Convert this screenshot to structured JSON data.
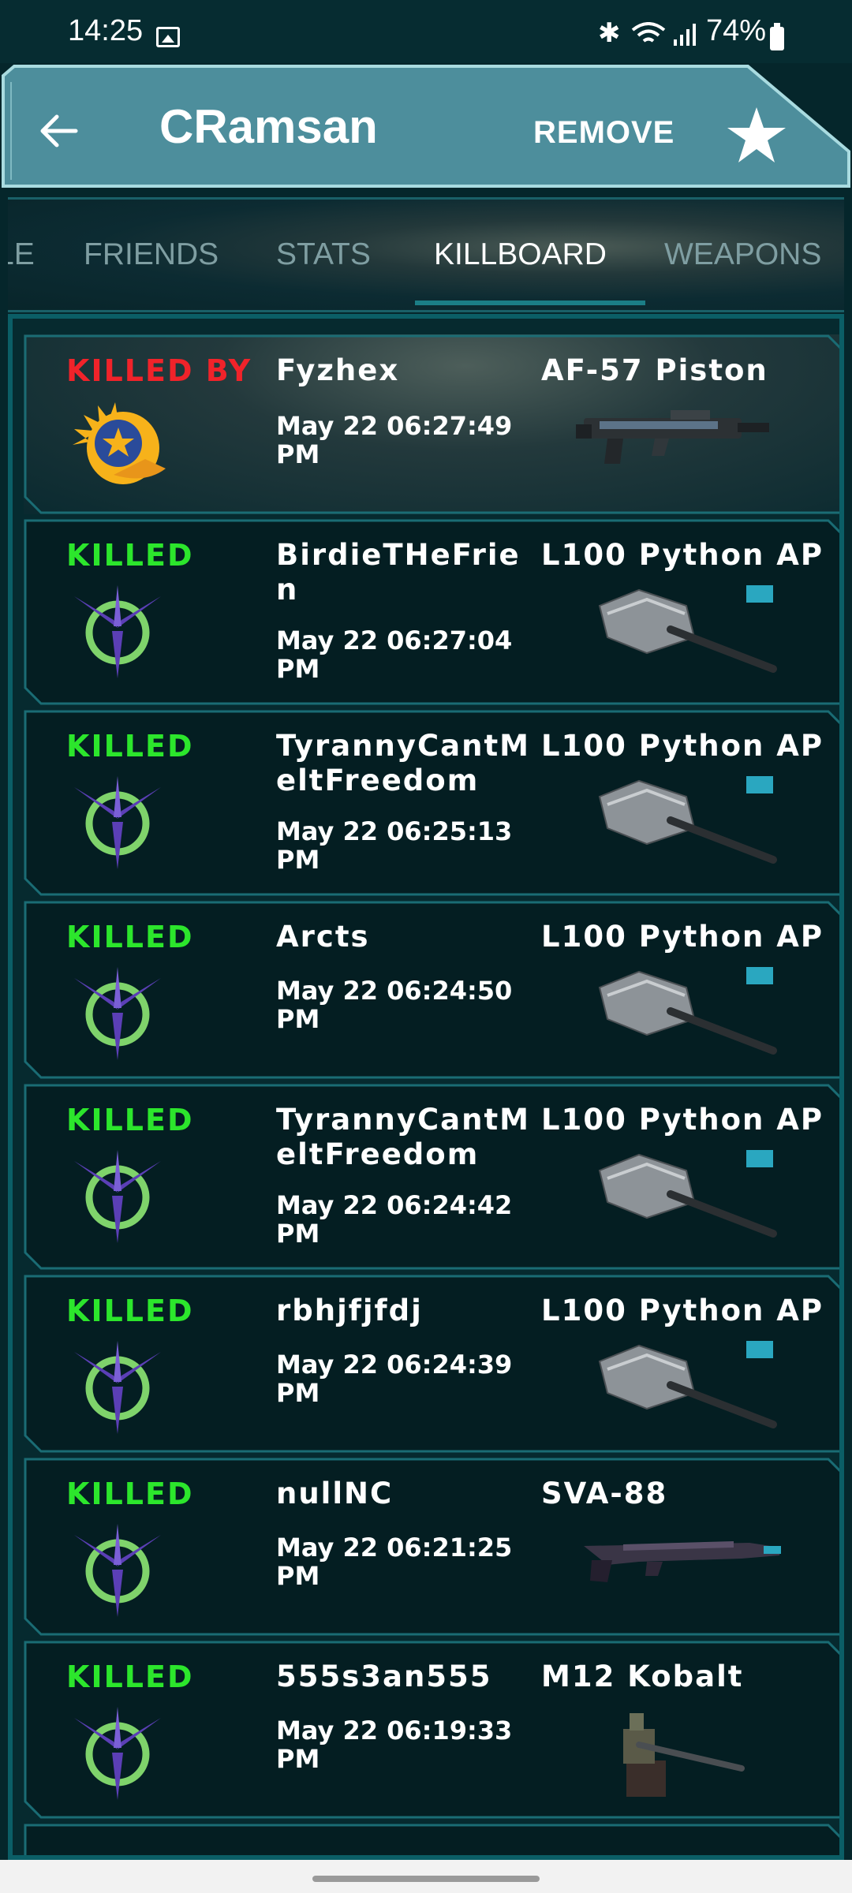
{
  "status_bar": {
    "time": "14:25",
    "battery": "74%",
    "icons": [
      "gallery-icon",
      "bluetooth-icon",
      "wifi-icon",
      "signal-icon",
      "battery-icon"
    ]
  },
  "header": {
    "title": "CRamsan",
    "remove_label": "REMOVE",
    "back_icon": "arrow-left-icon",
    "favorite_icon": "star-icon"
  },
  "tabs": [
    {
      "label": "LE",
      "active": false
    },
    {
      "label": "FRIENDS",
      "active": false
    },
    {
      "label": "STATS",
      "active": false
    },
    {
      "label": "KILLBOARD",
      "active": true
    },
    {
      "label": "WEAPONS",
      "active": false
    }
  ],
  "kills": [
    {
      "status": "KILLED BY",
      "player": "Fyzhex",
      "time": "May 22 06:27:49 PM",
      "weapon": "AF-57 Piston",
      "emblem": "sun-eagle-emblem",
      "weapon_icon": "rifle"
    },
    {
      "status": "KILLED",
      "player": "BirdieTHeFrien",
      "time": "May 22 06:27:04 PM",
      "weapon": "L100 Python AP",
      "emblem": "star-ring-emblem",
      "weapon_icon": "turret"
    },
    {
      "status": "KILLED",
      "player": "TyrannyCantMeltFreedom",
      "time": "May 22 06:25:13 PM",
      "weapon": "L100 Python AP",
      "emblem": "star-ring-emblem",
      "weapon_icon": "turret"
    },
    {
      "status": "KILLED",
      "player": "Arcts",
      "time": "May 22 06:24:50 PM",
      "weapon": "L100 Python AP",
      "emblem": "star-ring-emblem",
      "weapon_icon": "turret"
    },
    {
      "status": "KILLED",
      "player": "TyrannyCantMeltFreedom",
      "time": "May 22 06:24:42 PM",
      "weapon": "L100 Python AP",
      "emblem": "star-ring-emblem",
      "weapon_icon": "turret"
    },
    {
      "status": "KILLED",
      "player": "rbhjfjfdj",
      "time": "May 22 06:24:39 PM",
      "weapon": "L100 Python AP",
      "emblem": "star-ring-emblem",
      "weapon_icon": "turret"
    },
    {
      "status": "KILLED",
      "player": "nullNC",
      "time": "May 22 06:21:25 PM",
      "weapon": "SVA-88",
      "emblem": "star-ring-emblem",
      "weapon_icon": "sniper"
    },
    {
      "status": "KILLED",
      "player": "555s3an555",
      "time": "May 22 06:19:33 PM",
      "weapon": "M12 Kobalt",
      "emblem": "star-ring-emblem",
      "weapon_icon": "mounted-gun"
    }
  ],
  "colors": {
    "killed": "#2ce62c",
    "killed_by": "#f0232a",
    "header_bg": "#4d8e9c",
    "accent": "#1b7e86"
  }
}
